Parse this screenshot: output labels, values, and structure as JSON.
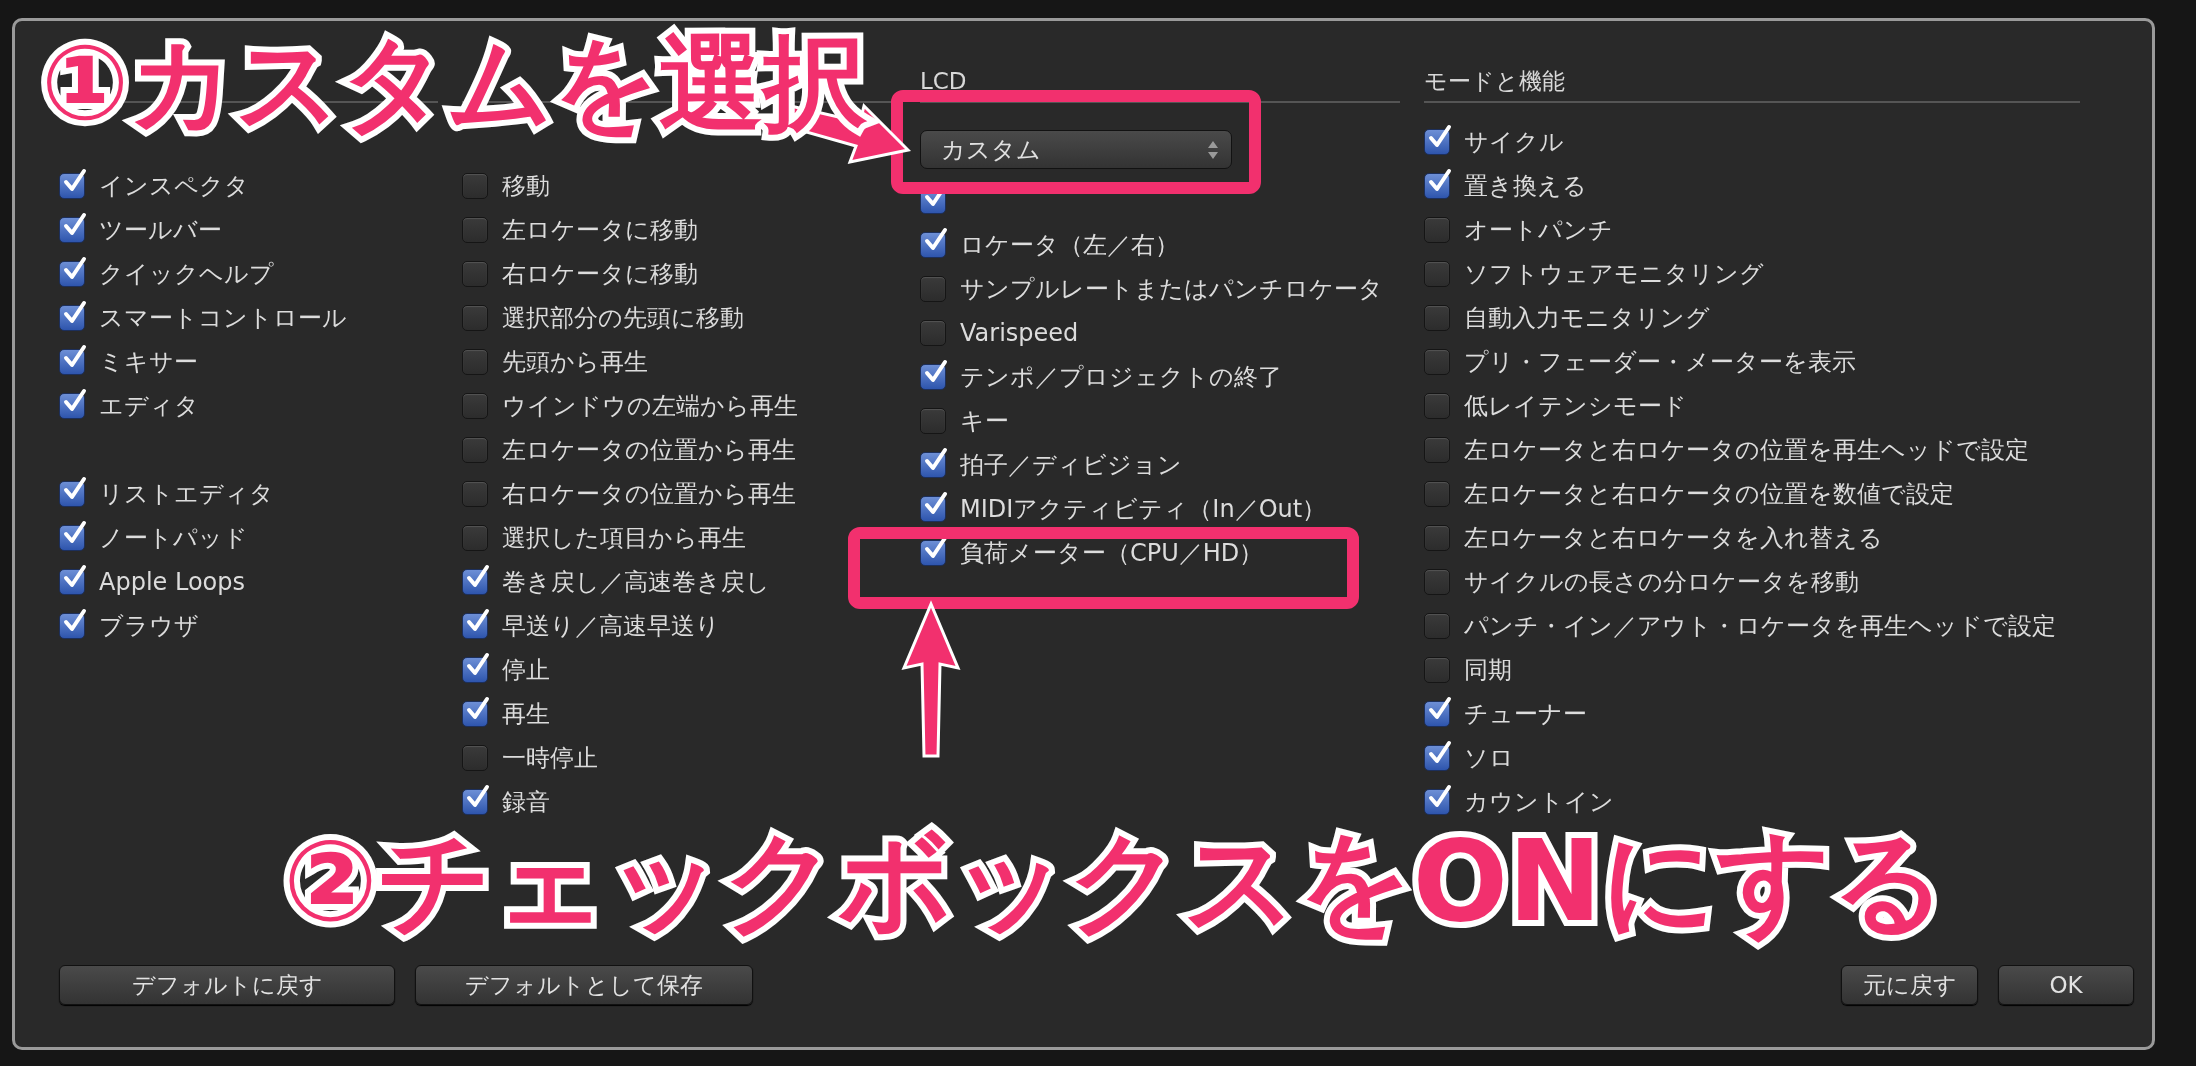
{
  "dialog": {
    "columns": [
      {
        "items": [
          {
            "kind": "gap"
          },
          {
            "kind": "check",
            "label": "インスペクタ",
            "checked": true
          },
          {
            "kind": "check",
            "label": "ツールバー",
            "checked": true
          },
          {
            "kind": "check",
            "label": "クイックヘルプ",
            "checked": true
          },
          {
            "kind": "check",
            "label": "スマートコントロール",
            "checked": true
          },
          {
            "kind": "check",
            "label": "ミキサー",
            "checked": true
          },
          {
            "kind": "check",
            "label": "エディタ",
            "checked": true
          },
          {
            "kind": "gap"
          },
          {
            "kind": "check",
            "label": "リストエディタ",
            "checked": true
          },
          {
            "kind": "check",
            "label": "ノートパッド",
            "checked": true
          },
          {
            "kind": "check",
            "label": "Apple Loops",
            "checked": true
          },
          {
            "kind": "check",
            "label": "ブラウザ",
            "checked": true
          }
        ]
      },
      {
        "items": [
          {
            "kind": "gap"
          },
          {
            "kind": "check",
            "label": "移動",
            "checked": false
          },
          {
            "kind": "check",
            "label": "左ロケータに移動",
            "checked": false
          },
          {
            "kind": "check",
            "label": "右ロケータに移動",
            "checked": false
          },
          {
            "kind": "check",
            "label": "選択部分の先頭に移動",
            "checked": false
          },
          {
            "kind": "check",
            "label": "先頭から再生",
            "checked": false
          },
          {
            "kind": "check",
            "label": "ウインドウの左端から再生",
            "checked": false
          },
          {
            "kind": "check",
            "label": "左ロケータの位置から再生",
            "checked": false
          },
          {
            "kind": "check",
            "label": "右ロケータの位置から再生",
            "checked": false
          },
          {
            "kind": "check",
            "label": "選択した項目から再生",
            "checked": false
          },
          {
            "kind": "check",
            "label": "巻き戻し／高速巻き戻し",
            "checked": true
          },
          {
            "kind": "check",
            "label": "早送り／高速早送り",
            "checked": true
          },
          {
            "kind": "check",
            "label": "停止",
            "checked": true
          },
          {
            "kind": "check",
            "label": "再生",
            "checked": true
          },
          {
            "kind": "check",
            "label": "一時停止",
            "checked": false
          },
          {
            "kind": "check",
            "label": "録音",
            "checked": true
          }
        ]
      },
      {
        "title": "LCD",
        "items": [
          {
            "kind": "select",
            "value": "カスタム"
          },
          {
            "kind": "check",
            "checked": true
          },
          {
            "kind": "check",
            "label": "ロケータ（左／右）",
            "checked": true
          },
          {
            "kind": "check",
            "label": "サンプルレートまたはパンチロケータ",
            "checked": false
          },
          {
            "kind": "check",
            "label": "Varispeed",
            "checked": false
          },
          {
            "kind": "check",
            "label": "テンポ／プロジェクトの終了",
            "checked": true
          },
          {
            "kind": "check",
            "label": "キー",
            "checked": false
          },
          {
            "kind": "check",
            "label": "拍子／ディビジョン",
            "checked": true
          },
          {
            "kind": "check",
            "label": "MIDIアクティビティ（In／Out）",
            "checked": true
          },
          {
            "kind": "check",
            "label": "負荷メーター（CPU／HD）",
            "checked": true
          }
        ]
      },
      {
        "title": "モードと機能",
        "items": [
          {
            "kind": "check",
            "label": "サイクル",
            "checked": true
          },
          {
            "kind": "check",
            "label": "置き換える",
            "checked": true
          },
          {
            "kind": "check",
            "label": "オートパンチ",
            "checked": false
          },
          {
            "kind": "check",
            "label": "ソフトウェアモニタリング",
            "checked": false
          },
          {
            "kind": "check",
            "label": "自動入力モニタリング",
            "checked": false
          },
          {
            "kind": "check",
            "label": "プリ・フェーダー・メーターを表示",
            "checked": false
          },
          {
            "kind": "check",
            "label": "低レイテンシモード",
            "checked": false
          },
          {
            "kind": "check",
            "label": "左ロケータと右ロケータの位置を再生ヘッドで設定",
            "checked": false
          },
          {
            "kind": "check",
            "label": "左ロケータと右ロケータの位置を数値で設定",
            "checked": false
          },
          {
            "kind": "check",
            "label": "左ロケータと右ロケータを入れ替える",
            "checked": false
          },
          {
            "kind": "check",
            "label": "サイクルの長さの分ロケータを移動",
            "checked": false
          },
          {
            "kind": "check",
            "label": "パンチ・イン／アウト・ロケータを再生ヘッドで設定",
            "checked": false
          },
          {
            "kind": "check",
            "label": "同期",
            "checked": false
          },
          {
            "kind": "check",
            "label": "チューナー",
            "checked": true
          },
          {
            "kind": "check",
            "label": "ソロ",
            "checked": true
          },
          {
            "kind": "check",
            "label": "カウントイン",
            "checked": true
          }
        ]
      }
    ],
    "buttons_left": [
      {
        "label": "デフォルトに戻す"
      },
      {
        "label": "デフォルトとして保存"
      }
    ],
    "buttons_right": [
      {
        "label": "元に戻す"
      },
      {
        "label": "OK"
      }
    ]
  },
  "annotations": [
    {
      "kind": "step",
      "text": "①カスタムを選択"
    },
    {
      "kind": "step",
      "text": "②チェックボックスをONにする"
    }
  ]
}
